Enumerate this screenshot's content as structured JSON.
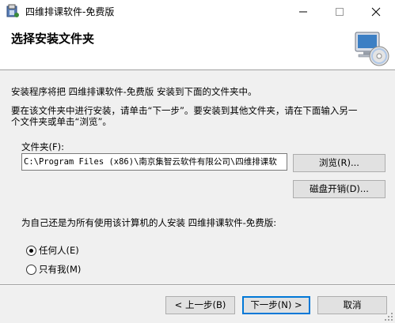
{
  "window": {
    "title": "四维排课软件-免费版",
    "icons": [
      "app-setup-icon",
      "minimize-icon",
      "maximize-icon",
      "close-icon",
      "computer-disc-icon"
    ]
  },
  "header": {
    "title": "选择安装文件夹"
  },
  "body": {
    "intro": "安装程序将把 四维排课软件-免费版 安装到下面的文件夹中。",
    "instructions_line1": "要在该文件夹中进行安装，请单击“下一步”。要安装到其他文件夹，请在下面输入另一",
    "instructions_line2": "个文件夹或单击“浏览”。",
    "folder_label": "文件夹(F):",
    "folder_value": "C:\\Program Files (x86)\\南京集智云软件有限公司\\四维排课软",
    "browse_button": "浏览(R)...",
    "disk_cost_button": "磁盘开销(D)...",
    "install_for_label": "为自己还是为所有使用该计算机的人安装 四维排课软件-免费版:",
    "radio_everyone": "任何人(E)",
    "radio_just_me": "只有我(M)",
    "selected_option": "任何人(E)"
  },
  "footer": {
    "back_button": "< 上一步(B)",
    "next_button": "下一步(N) >",
    "cancel_button": "取消"
  },
  "colors": {
    "window_bg": "#f0f0f0",
    "header_bg": "#ffffff",
    "default_button_border": "#0078d7"
  }
}
